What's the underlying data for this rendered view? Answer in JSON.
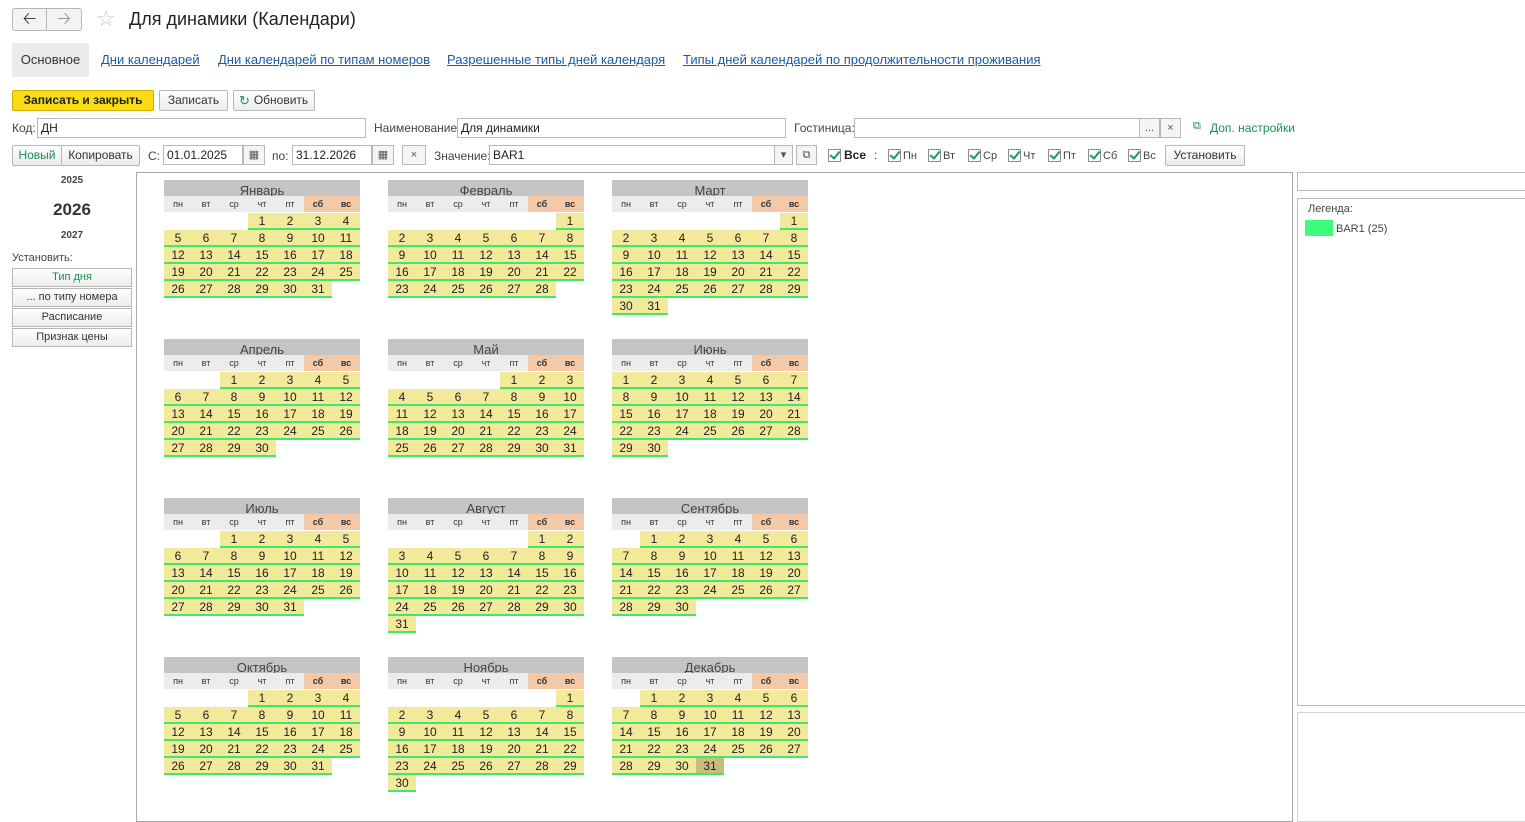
{
  "window": {
    "title": "Для динамики (Календари)"
  },
  "tabs": [
    {
      "label": "Основное",
      "active": true
    },
    {
      "label": "Дни календарей"
    },
    {
      "label": "Дни календарей по типам номеров"
    },
    {
      "label": "Разрешенные типы дней календаря"
    },
    {
      "label": "Типы дней календарей по продолжительности проживания"
    }
  ],
  "toolbar": {
    "save_close": "Записать и закрыть",
    "save": "Записать",
    "refresh": "Обновить"
  },
  "form": {
    "code_label": "Код:",
    "code_value": "ДН",
    "name_label": "Наименование:",
    "name_value": "Для динамики",
    "hotel_label": "Гостиница:",
    "hotel_value": "",
    "extra_settings": "Доп. настройки"
  },
  "filter": {
    "new": "Новый",
    "copy": "Копировать",
    "from_label": "С:",
    "from_value": "01.01.2025",
    "to_label": "по:",
    "to_value": "31.12.2026",
    "clear": "×",
    "value_label": "Значение:",
    "value_value": "BAR1",
    "all_label": "Все",
    "colon": ":",
    "days": [
      "Пн",
      "Вт",
      "Ср",
      "Чт",
      "Пт",
      "Сб",
      "Вс"
    ],
    "set_button": "Установить"
  },
  "years": {
    "prev": "2025",
    "current": "2026",
    "next": "2027"
  },
  "set_panel": {
    "label": "Установить:",
    "buttons": [
      "Тип дня",
      "... по типу номера",
      "Расписание",
      "Признак цены"
    ]
  },
  "weekday_short": [
    "пн",
    "вт",
    "ср",
    "чт",
    "пт",
    "сб",
    "вс"
  ],
  "months": [
    {
      "name": "Январь",
      "start": 3,
      "days": 31
    },
    {
      "name": "Февраль",
      "start": 6,
      "days": 28
    },
    {
      "name": "Март",
      "start": 6,
      "days": 31
    },
    {
      "name": "Апрель",
      "start": 2,
      "days": 30
    },
    {
      "name": "Май",
      "start": 4,
      "days": 31
    },
    {
      "name": "Июнь",
      "start": 0,
      "days": 30
    },
    {
      "name": "Июль",
      "start": 2,
      "days": 31
    },
    {
      "name": "Август",
      "start": 5,
      "days": 31
    },
    {
      "name": "Сентябрь",
      "start": 1,
      "days": 30
    },
    {
      "name": "Октябрь",
      "start": 3,
      "days": 31
    },
    {
      "name": "Ноябрь",
      "start": 6,
      "days": 30
    },
    {
      "name": "Декабрь",
      "start": 1,
      "days": 31,
      "highlight": 31
    }
  ],
  "legend": {
    "title": "Легенда:",
    "items": [
      {
        "label": "BAR1 (25)",
        "color": "#3efb7b"
      }
    ]
  },
  "colors": {
    "day_fill": "#f3e99a",
    "day_underline": "#3ee86a",
    "weekend_header": "#f3c9a8",
    "primary_button": "#f9dc13"
  }
}
